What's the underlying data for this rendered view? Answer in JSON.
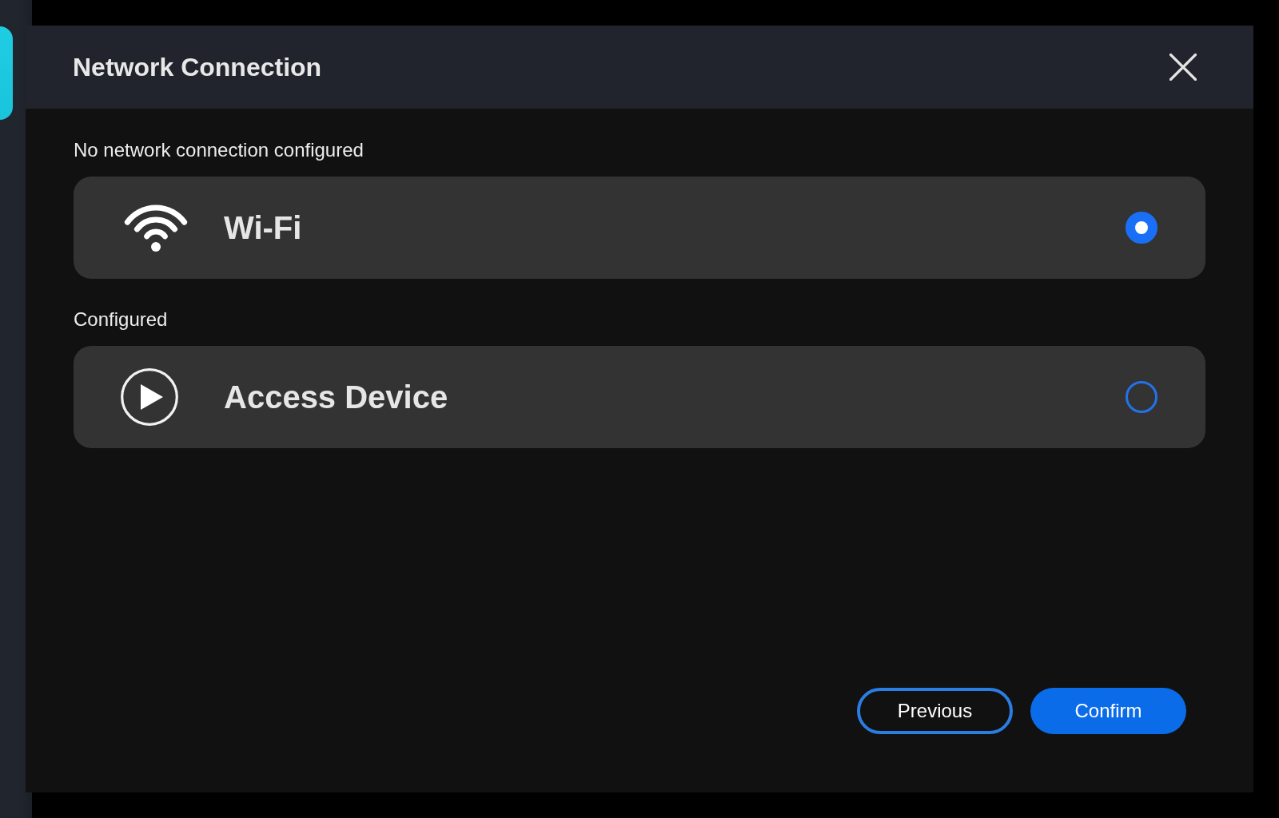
{
  "dialog": {
    "title": "Network Connection",
    "sections": [
      {
        "heading": "No network connection configured",
        "options": [
          {
            "kind": "wifi",
            "label": "Wi-Fi",
            "selected": true
          }
        ]
      },
      {
        "heading": "Configured",
        "options": [
          {
            "kind": "play",
            "label": "Access Device",
            "selected": false
          }
        ]
      }
    ],
    "buttons": [
      {
        "kind": "outline",
        "label": "Previous"
      },
      {
        "kind": "primary",
        "label": "Confirm"
      }
    ]
  }
}
